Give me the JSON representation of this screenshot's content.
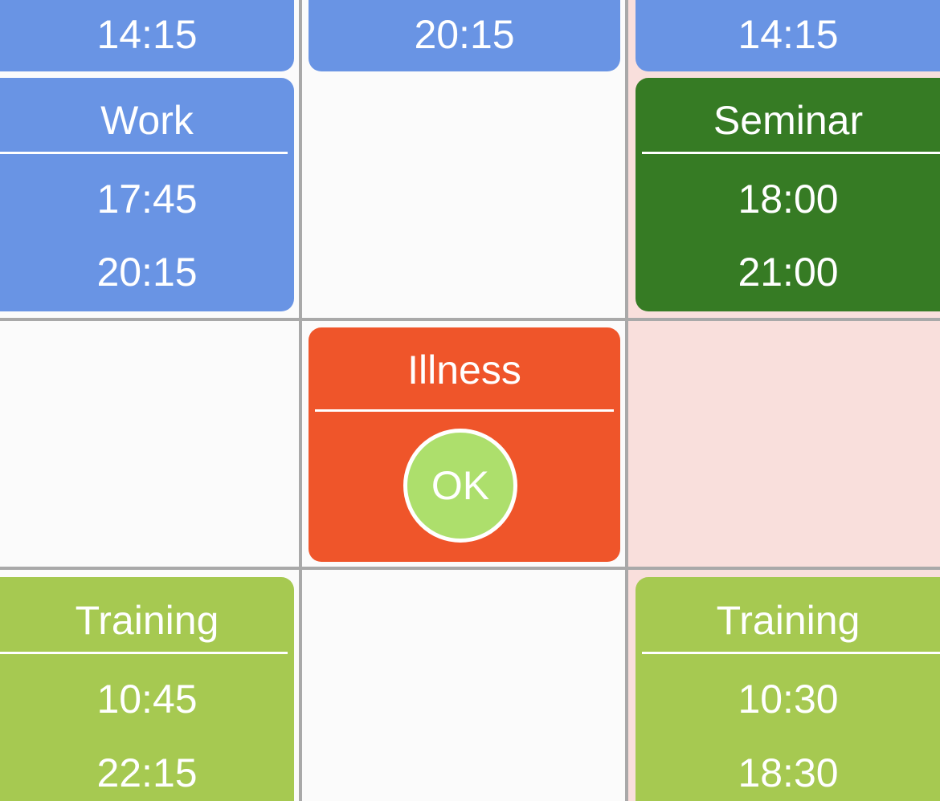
{
  "colors": {
    "work": "#6994e4",
    "seminar": "#367b24",
    "illness": "#ef552a",
    "training": "#a6c951",
    "ok_button": "#addf6c",
    "highlight_column": "#f9dfdc",
    "grid_line": "#a9a9a9"
  },
  "rows": [
    {
      "cells": [
        {
          "end_time": "14:15"
        },
        {
          "end_time": "20:15"
        },
        {
          "end_time": "14:15"
        }
      ]
    },
    {
      "cells": [
        {
          "title": "Work",
          "start": "17:45",
          "end": "20:15"
        },
        null,
        {
          "title": "Seminar",
          "start": "18:00",
          "end": "21:00"
        }
      ]
    },
    {
      "cells": [
        null,
        {
          "title": "Illness",
          "button": "OK"
        },
        null
      ]
    },
    {
      "cells": [
        {
          "title": "Training",
          "start": "10:45",
          "end": "22:15"
        },
        null,
        {
          "title": "Training",
          "start": "10:30",
          "end": "18:30"
        }
      ]
    }
  ]
}
